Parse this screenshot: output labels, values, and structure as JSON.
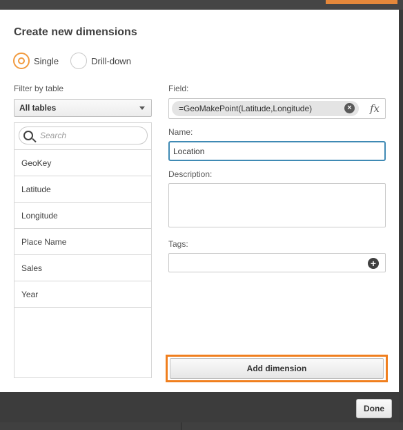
{
  "dialog": {
    "title": "Create new dimensions",
    "mode_options": [
      {
        "label": "Single",
        "selected": true
      },
      {
        "label": "Drill-down",
        "selected": false
      }
    ]
  },
  "left_panel": {
    "filter_label": "Filter by table",
    "filter_selected": "All tables",
    "search_placeholder": "Search",
    "fields": [
      "GeoKey",
      "Latitude",
      "Longitude",
      "Place Name",
      "Sales",
      "Year"
    ]
  },
  "right_panel": {
    "field_label": "Field:",
    "field_value": "=GeoMakePoint(Latitude,Longitude)",
    "fx_symbol": "fx",
    "name_label": "Name:",
    "name_value": "Location",
    "description_label": "Description:",
    "description_value": "",
    "tags_label": "Tags:",
    "add_button": "Add dimension"
  },
  "footer": {
    "done_button": "Done"
  },
  "colors": {
    "accent_orange": "#f19a3e",
    "highlight_orange": "#f07f1e",
    "focus_blue": "#3f8ab4",
    "overlay_dark": "#3c3c3c"
  }
}
